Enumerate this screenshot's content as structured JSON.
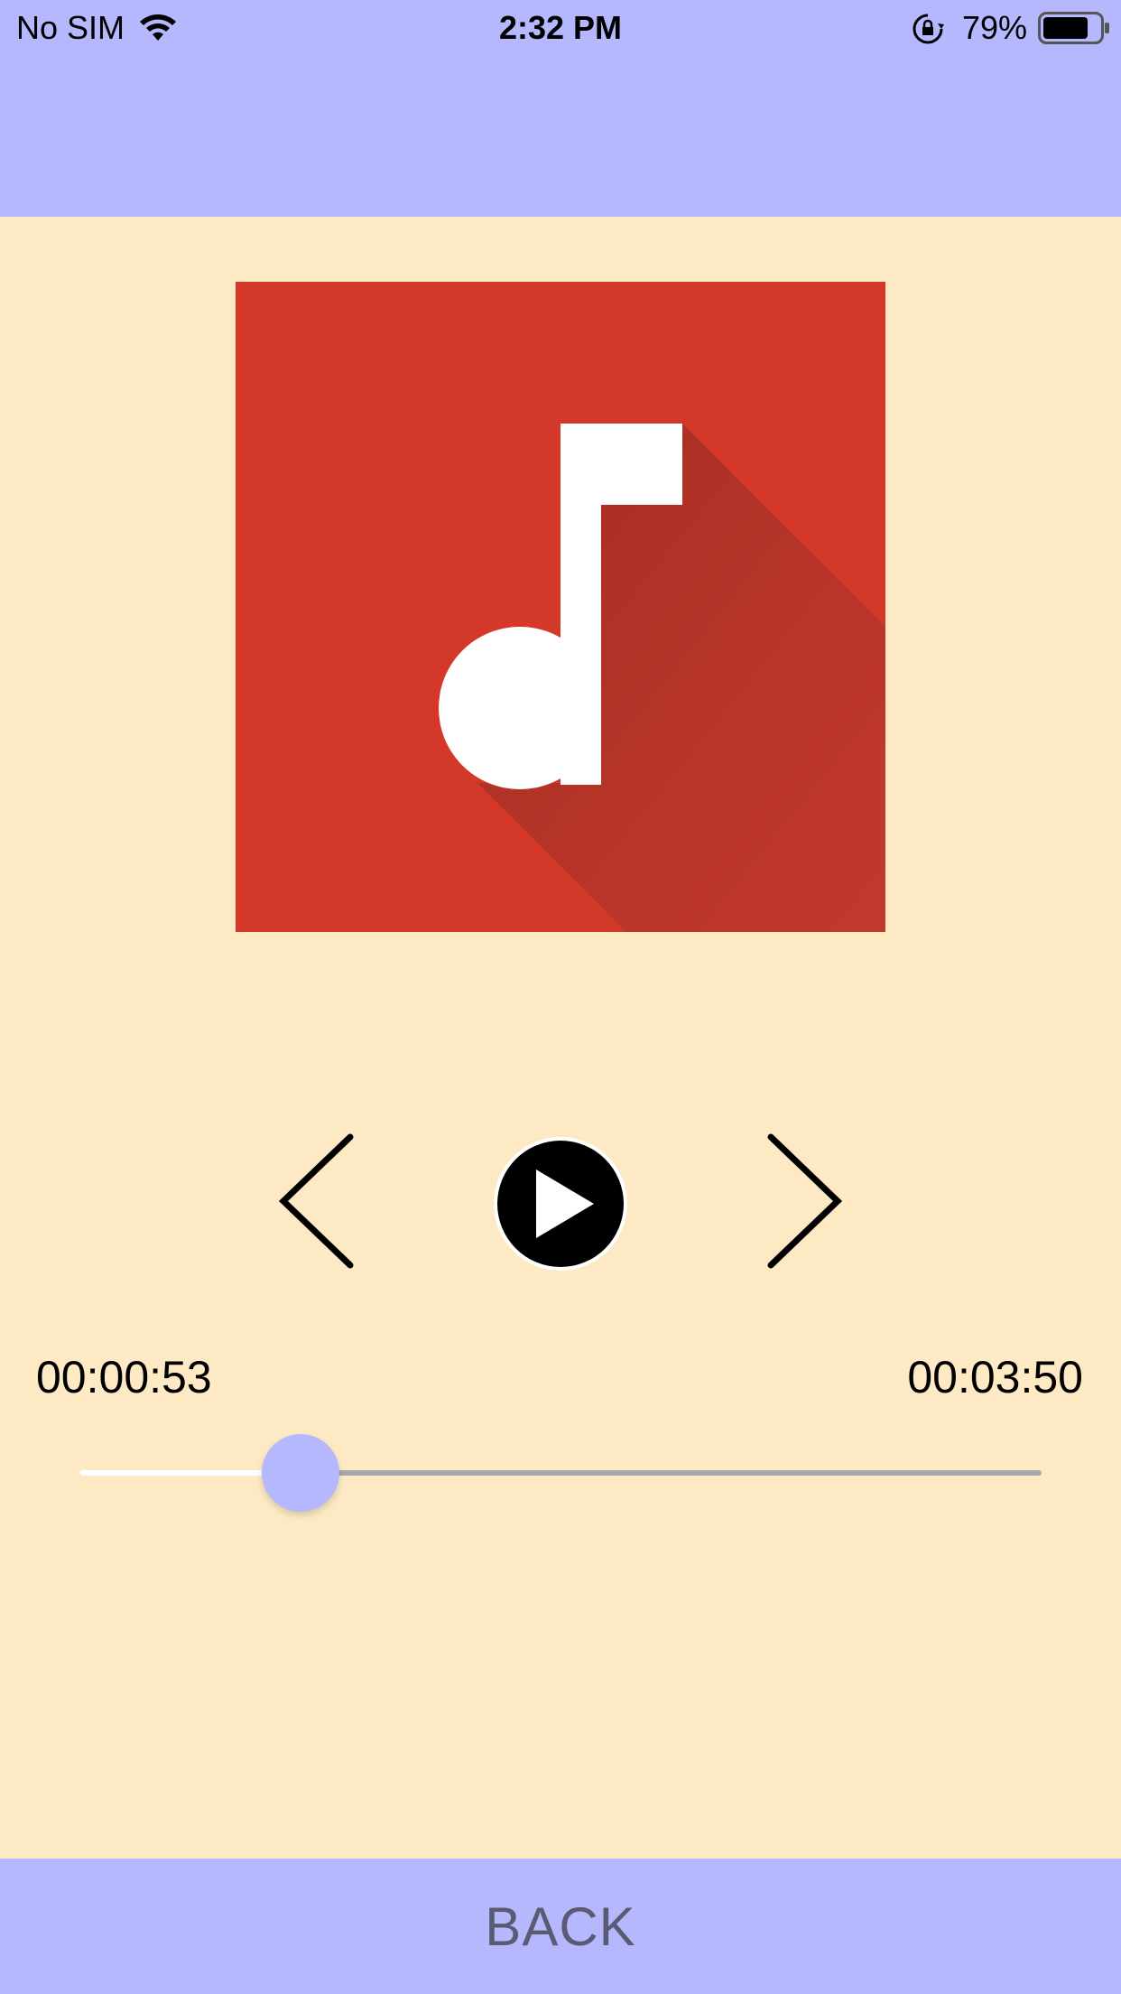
{
  "status_bar": {
    "carrier": "No SIM",
    "time": "2:32 PM",
    "battery_percent": "79%",
    "battery_level": 0.79,
    "icons": [
      "wifi-icon",
      "orientation-lock-icon",
      "battery-icon"
    ]
  },
  "artwork": {
    "icon": "music-note-icon",
    "background_color": "#d33828"
  },
  "controls": {
    "previous_icon": "chevron-left-icon",
    "play_icon": "play-icon",
    "next_icon": "chevron-right-icon"
  },
  "playback": {
    "elapsed": "00:00:53",
    "duration": "00:03:50",
    "progress_fraction": 0.23
  },
  "footer": {
    "back_label": "BACK"
  },
  "colors": {
    "header_bar": "#b5b8fc",
    "background": "#fdeac4",
    "accent": "#b5b8fc"
  }
}
